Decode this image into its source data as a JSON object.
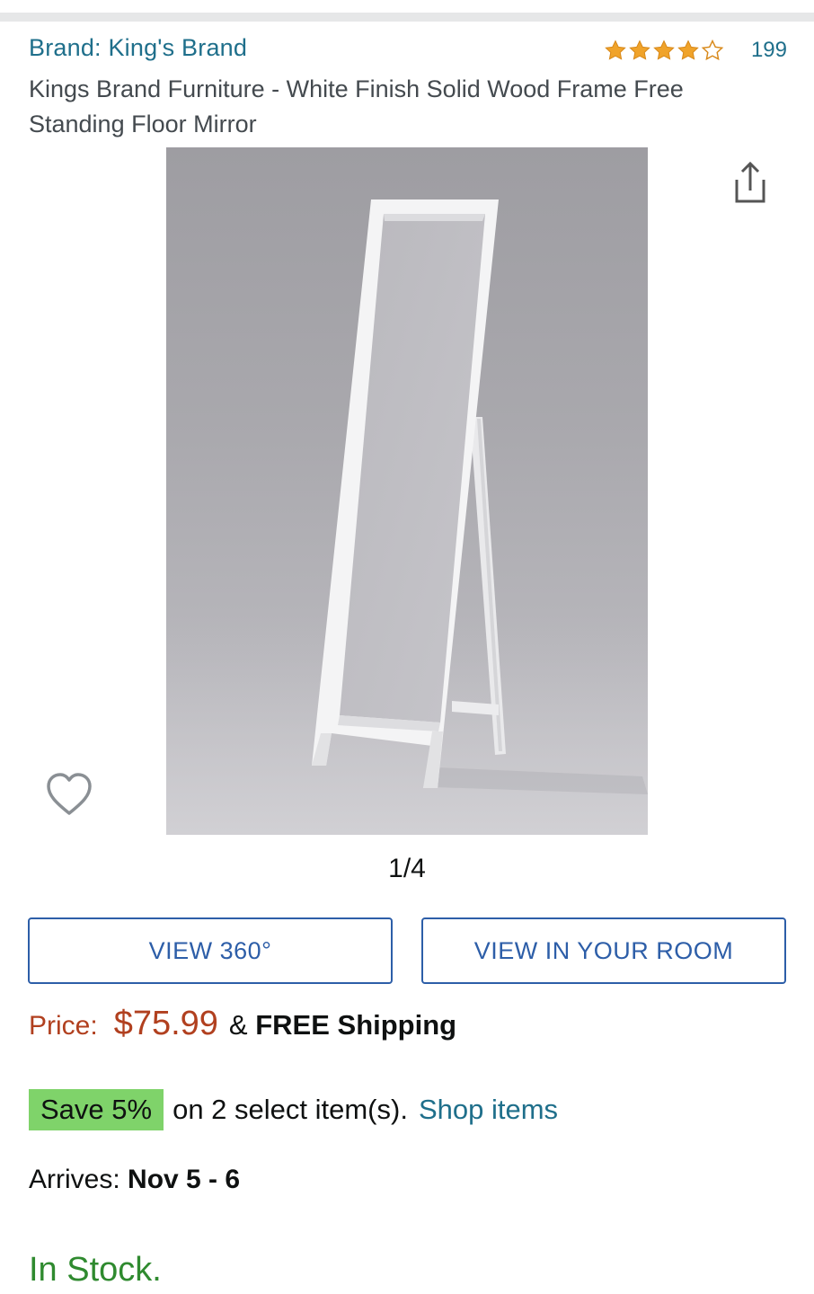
{
  "header": {
    "brand_link": "Brand: King's Brand",
    "rating_value": 4,
    "rating_max": 5,
    "rating_count": "199",
    "title": "Kings Brand Furniture - White Finish Solid Wood Frame Free Standing Floor Mirror"
  },
  "gallery": {
    "counter": "1/4",
    "share_icon": "share-icon",
    "wishlist_icon": "heart-outline-icon"
  },
  "actions": {
    "view_360": "VIEW 360°",
    "view_in_room": "VIEW IN YOUR ROOM"
  },
  "pricing": {
    "label": "Price:",
    "value": "$75.99",
    "amp": "&",
    "shipping": "FREE Shipping"
  },
  "promo": {
    "badge": "Save 5%",
    "text": "on 2 select item(s).",
    "link": "Shop items"
  },
  "delivery": {
    "label": "Arrives:",
    "dates": "Nov 5 - 6"
  },
  "availability": {
    "status": "In Stock."
  },
  "colors": {
    "link": "#1f6f8b",
    "price": "#b1401f",
    "button": "#2d5ea8",
    "save_badge": "#7fd36a",
    "in_stock": "#2f8a2f",
    "star": "#f0a32a"
  }
}
